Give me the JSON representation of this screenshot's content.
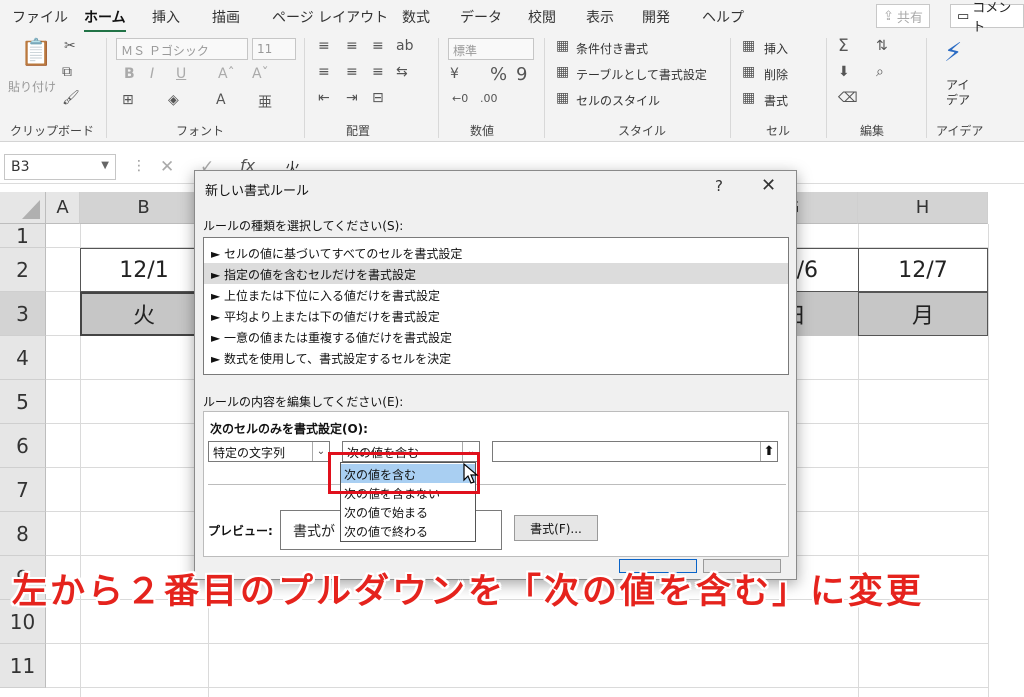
{
  "ribbon_tabs": [
    "ファイル",
    "ホーム",
    "挿入",
    "描画",
    "ページ レイアウト",
    "数式",
    "データ",
    "校閲",
    "表示",
    "開発",
    "ヘルプ"
  ],
  "share_button": "共有",
  "comment_button": "コメント",
  "ribbon": {
    "clipboard": {
      "paste": "貼り付け",
      "label": "クリップボード"
    },
    "font": {
      "font_name": "ＭＳ Ｐゴシック",
      "font_size": "11",
      "label": "フォント"
    },
    "alignment": {
      "label": "配置"
    },
    "number": {
      "format": "標準",
      "label": "数値"
    },
    "styles": {
      "conditional": "条件付き書式",
      "table": "テーブルとして書式設定",
      "cell_style": "セルのスタイル",
      "label": "スタイル"
    },
    "cells": {
      "insert": "挿入",
      "delete": "削除",
      "format": "書式",
      "label": "セル"
    },
    "editing": {
      "label": "編集"
    },
    "ideas": {
      "button": "アイデア",
      "label": "アイデア"
    }
  },
  "formula_bar": {
    "name_box": "B3",
    "fx": "fx",
    "content": "火"
  },
  "sheet": {
    "columns": [
      "A",
      "B",
      "G",
      "H"
    ],
    "rows": [
      "1",
      "2",
      "3",
      "4",
      "5",
      "6",
      "7",
      "8",
      "9",
      "10",
      "11"
    ],
    "cells": {
      "B2": "12/1",
      "B3": "火",
      "G2": "/6",
      "G3": "日",
      "H2": "12/7",
      "H3": "月"
    }
  },
  "dialog": {
    "title": "新しい書式ルール",
    "help": "?",
    "close": "✕",
    "rule_type_label": "ルールの種類を選択してください(S):",
    "rule_types": [
      "► セルの値に基づいてすべてのセルを書式設定",
      "► 指定の値を含むセルだけを書式設定",
      "► 上位または下位に入る値だけを書式設定",
      "► 平均より上または下の値だけを書式設定",
      "► 一意の値または重複する値だけを書式設定",
      "► 数式を使用して、書式設定するセルを決定"
    ],
    "edit_label": "ルールの内容を編集してください(E):",
    "format_only_label": "次のセルのみを書式設定(O):",
    "combo1": "特定の文字列",
    "combo2": "次の値を含む",
    "dropdown_options": [
      "次の値を含む",
      "次の値を含まない",
      "次の値で始まる",
      "次の値で終わる"
    ],
    "preview_label": "プレビュー:",
    "preview_text": "書式が",
    "format_button": "書式(F)..."
  },
  "caption": "左から２番目のプルダウンを「次の値を含む」に変更"
}
